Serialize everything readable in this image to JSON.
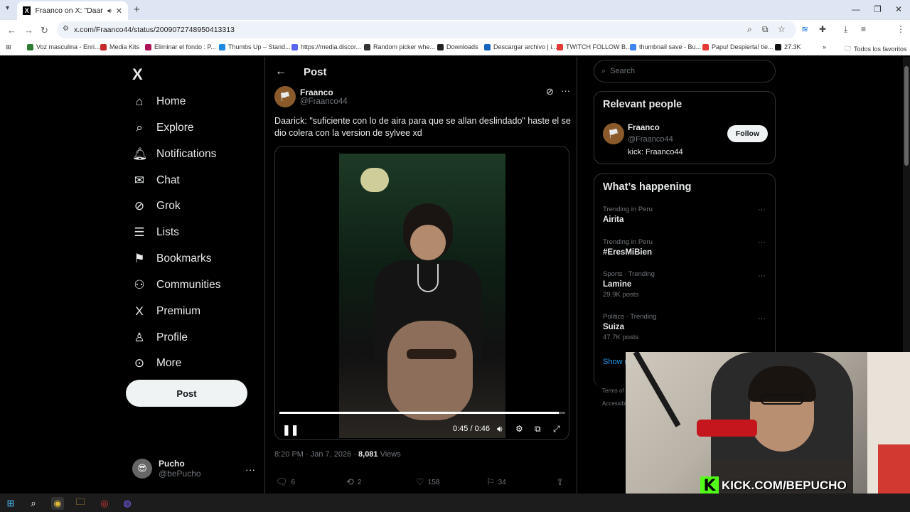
{
  "browser": {
    "tab_title": "Fraanco on X: \"Daarick: \"su",
    "url": "x.com/Fraanco44/status/2009072748950413313",
    "bookmarks": [
      {
        "label": "Voz masculina - Enri...",
        "color": "#2e7d32"
      },
      {
        "label": "Media Kits",
        "color": "#c62828"
      },
      {
        "label": "Eliminar el fondo : P...",
        "color": "#ad1457"
      },
      {
        "label": "Thumbs Up – Stand...",
        "color": "#1e88e5"
      },
      {
        "label": "https://media.discor...",
        "color": "#5865f2"
      },
      {
        "label": "Random picker whe...",
        "color": "#333333"
      },
      {
        "label": "Downloads",
        "color": "#222222"
      },
      {
        "label": "Descargar archivo | i...",
        "color": "#1565c0"
      },
      {
        "label": "TWITCH FOLLOW B...",
        "color": "#e53935"
      },
      {
        "label": "thumbnail save - Bu...",
        "color": "#4285f4"
      },
      {
        "label": "Papu! Despierta! tie...",
        "color": "#e53935"
      },
      {
        "label": "27.3K",
        "color": "#111111"
      }
    ],
    "all_bookmarks": "Todos los favoritos"
  },
  "sidebar": {
    "logo": "X",
    "items": [
      {
        "label": "Home",
        "icon": "home-icon",
        "glyph": "⌂"
      },
      {
        "label": "Explore",
        "icon": "search-icon",
        "glyph": "⌕"
      },
      {
        "label": "Notifications",
        "icon": "bell-icon",
        "glyph": "🔔︎"
      },
      {
        "label": "Chat",
        "icon": "mail-icon",
        "glyph": "✉"
      },
      {
        "label": "Grok",
        "icon": "grok-icon",
        "glyph": "⊘"
      },
      {
        "label": "Lists",
        "icon": "list-icon",
        "glyph": "☰"
      },
      {
        "label": "Bookmarks",
        "icon": "bookmark-icon",
        "glyph": "⚑"
      },
      {
        "label": "Communities",
        "icon": "communities-icon",
        "glyph": "⚇"
      },
      {
        "label": "Premium",
        "icon": "x-premium-icon",
        "glyph": "X"
      },
      {
        "label": "Profile",
        "icon": "profile-icon",
        "glyph": "♙"
      },
      {
        "label": "More",
        "icon": "more-circle-icon",
        "glyph": "⊙"
      }
    ],
    "post_button": "Post",
    "account": {
      "name": "Pucho",
      "handle": "@bePucho"
    }
  },
  "main": {
    "header_title": "Post",
    "author_name": "Fraanco",
    "author_handle": "@Fraanco44",
    "text": "Daarick: \"suficiente con lo de aira para que se allan deslindado\"  haste el se dio colera con la version de sylvee xd",
    "video": {
      "time": "0:45 / 0:46",
      "progress": 0.978
    },
    "meta_time": "8:20 PM · Jan 7, 2026 · ",
    "views_count": "8,081",
    "views_label": " Views",
    "actions": {
      "replies": "6",
      "reposts": "2",
      "likes": "158",
      "bookmarks": "34"
    }
  },
  "right": {
    "search_placeholder": "Search",
    "relevant_title": "Relevant people",
    "person": {
      "name": "Fraanco",
      "handle": "@Fraanco44",
      "bio": "kick: Fraanco44",
      "follow": "Follow"
    },
    "happening_title": "What’s happening",
    "trends": [
      {
        "context": "Trending in Peru",
        "name": "Airita",
        "count": ""
      },
      {
        "context": "Trending in Peru",
        "name": "#EresMiBien",
        "count": ""
      },
      {
        "context": "Sports · Trending",
        "name": "Lamine",
        "count": "29.9K posts"
      },
      {
        "context": "Politics · Trending",
        "name": "Suiza",
        "count": "47.7K posts"
      }
    ],
    "show_more": "Show m",
    "footer": [
      "Terms of S",
      "Accessibil"
    ]
  },
  "overlay": {
    "kick": "KICK.COM/BEPUCHO",
    "kick_k": "K"
  }
}
